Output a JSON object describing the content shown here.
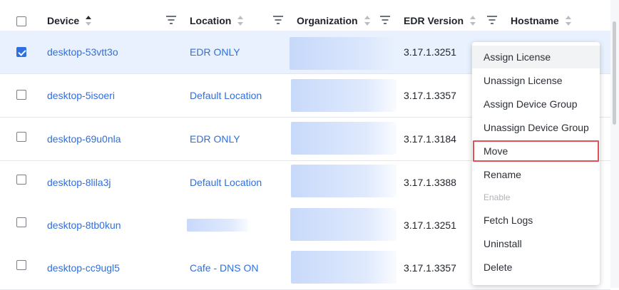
{
  "columns": {
    "device": "Device",
    "location": "Location",
    "organization": "Organization",
    "edr_version": "EDR Version",
    "hostname": "Hostname"
  },
  "rows": [
    {
      "device": "desktop-53vtt3o",
      "location": "EDR ONLY",
      "edr_version": "3.17.1.3251",
      "selected": true
    },
    {
      "device": "desktop-5isoeri",
      "location": "Default Location",
      "edr_version": "3.17.1.3357",
      "selected": false
    },
    {
      "device": "desktop-69u0nla",
      "location": "EDR ONLY",
      "edr_version": "3.17.1.3184",
      "selected": false
    },
    {
      "device": "desktop-8lila3j",
      "location": "Default Location",
      "edr_version": "3.17.1.3388",
      "selected": false
    },
    {
      "device": "desktop-8tb0kun",
      "location": "",
      "edr_version": "3.17.1.3251",
      "selected": false
    },
    {
      "device": "desktop-cc9ugl5",
      "location": "Cafe - DNS ON",
      "edr_version": "3.17.1.3357",
      "selected": false
    }
  ],
  "context_menu": {
    "items": [
      {
        "label": "Assign License",
        "state": "hover"
      },
      {
        "label": "Unassign License",
        "state": "normal"
      },
      {
        "label": "Assign Device Group",
        "state": "normal"
      },
      {
        "label": "Unassign Device Group",
        "state": "normal"
      },
      {
        "label": "Move",
        "state": "highlighted"
      },
      {
        "label": "Rename",
        "state": "normal"
      },
      {
        "label": "Enable",
        "state": "disabled"
      },
      {
        "label": "Fetch Logs",
        "state": "normal"
      },
      {
        "label": "Uninstall",
        "state": "normal"
      },
      {
        "label": "Delete",
        "state": "normal"
      }
    ]
  },
  "colors": {
    "link": "#2f6fde",
    "selected_row": "#e8f1fd",
    "highlight_outline": "#e0525a"
  },
  "icons": {
    "sort": "sort-arrows-icon",
    "filter": "filter-icon",
    "checkbox": "checkbox-icon"
  }
}
